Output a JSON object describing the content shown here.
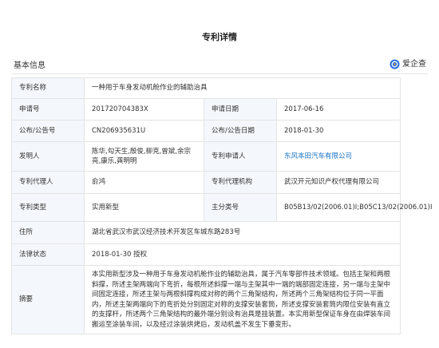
{
  "page_title": "专利详情",
  "section": {
    "title": "基本信息",
    "qcc_label": "爱企查"
  },
  "fields": {
    "name_label": "专利名称",
    "name_value": "一种用于车身发动机舱作业的辅助治具",
    "app_no_label": "申请号",
    "app_no_value": "201720704383X",
    "app_date_label": "申请日期",
    "app_date_value": "2017-06-16",
    "pub_no_label": "公布/公告号",
    "pub_no_value": "CN206935631U",
    "pub_date_label": "公布/公告日期",
    "pub_date_value": "2018-01-30",
    "inventor_label": "发明人",
    "inventor_value": "陈华,勾天生,殷俊,柳克,曾斌,余宗亮,康乐,龚明明",
    "applicant_label": "专利申请人",
    "applicant_value": "东风本田汽车有限公司",
    "agent_label": "专利代理人",
    "agent_value": "俞鸿",
    "agency_label": "专利代理机构",
    "agency_value": "武汉开元知识产权代理有限公司",
    "type_label": "专利类型",
    "type_value": "实用新型",
    "class_label": "主分类号",
    "class_value": "B05B13/02(2006.01)I;B05C13/02(2006.01)I",
    "address_label": "住所",
    "address_value": "湖北省武汉市武汉经济技术开发区车城东路283号",
    "legal_label": "法律状态",
    "legal_value": "2018-01-30 授权",
    "abstract_label": "摘要",
    "abstract_value": "本实用新型涉及一种用于车身发动机舱作业的辅助治具，属于汽车零部件技术领域。包括主架和两根斜撑，所述主架两端向下弯折，每根所述斜撑一端与主架其中一端的端部固定连接，另一端与主架中间固定连接，所述主架与两根斜撑构成对称的两个三角架结构，所述两个三角架结构位于同一平面内，所述主架两端向下的弯折处分别固定对称的支撑安装套筒，所述支撑安装套筒内限位安装有直立的支撑杆，所述两个三角架结构的最外端分别设有治具是挂装置。本实用新型保证车身在由焊装车间搬运至涂装车间，以及经过涂装烘烤后，发动机盖不发生下垂变形。"
  }
}
